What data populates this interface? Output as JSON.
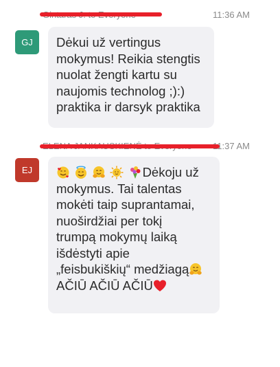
{
  "messages": [
    {
      "avatar_initials": "GJ",
      "avatar_color": "#2e9a78",
      "sender": "Gintaras J. to Everyone",
      "time": "11:36 AM",
      "lines": [
        "Dėkui už vertingus",
        "mokymus! Reikia stengtis",
        "nuolat žengti kartu su",
        "naujomis technolog ;):)",
        "praktika ir darsyk praktika"
      ]
    },
    {
      "avatar_initials": "EJ",
      "avatar_color": "#c0392b",
      "sender": "ELENA JANKAUSKIENĖ to Everyone",
      "time": "11:37 AM",
      "lead_emojis": [
        "smiling-face-with-hearts",
        "smiling-face-with-halo",
        "hugging-face",
        "sun-with-face",
        "bouquet"
      ],
      "first_line_text": "Dėkoju už",
      "lines": [
        "mokymus. Tai talentas",
        "mokėti taip suprantamai,",
        "nuoširdžiai per tokį",
        "trumpą mokymų laiką",
        "išdėstyti apie"
      ],
      "line_with_emoji": "„feisbukiškių“ medžiagą",
      "trailing_emoji_1": "hugging-face",
      "last_line": "AČIŪ AČIŪ AČIŪ",
      "trailing_emoji_2": "red-heart"
    }
  ]
}
